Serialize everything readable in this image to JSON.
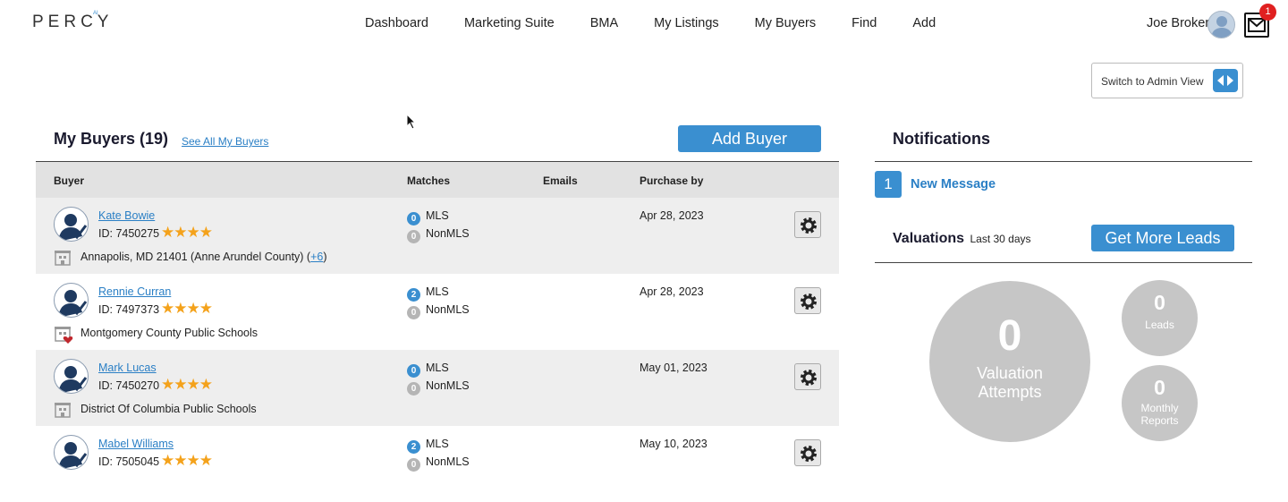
{
  "header": {
    "logo": "PERCY",
    "logo_sup": "AI",
    "nav": [
      "Dashboard",
      "Marketing Suite",
      "BMA",
      "My Listings",
      "My Buyers",
      "Find",
      "Add"
    ],
    "user_name": "Joe Broker",
    "mail_badge": "1"
  },
  "admin_toggle_label": "Switch to Admin View",
  "buyers": {
    "title": "My Buyers (19)",
    "see_all": "See All My Buyers",
    "add_button": "Add Buyer",
    "columns": {
      "buyer": "Buyer",
      "matches": "Matches",
      "emails": "Emails",
      "purchase_by": "Purchase by"
    },
    "rows": [
      {
        "name": "Kate Bowie",
        "id": "ID: 7450275",
        "stars": "★★★★",
        "location": "Annapolis, MD 21401 (Anne Arundel County) (",
        "location_more": "+6",
        "location_end": ")",
        "mls": "0",
        "nonmls": "0",
        "purchase_by": "Apr 28, 2023"
      },
      {
        "name": "Rennie Curran",
        "id": "ID: 7497373",
        "stars": "★★★★",
        "location": "Montgomery County Public Schools",
        "mls": "2",
        "nonmls": "0",
        "purchase_by": "Apr 28, 2023"
      },
      {
        "name": "Mark Lucas",
        "id": "ID: 7450270",
        "stars": "★★★★",
        "location": "District Of Columbia Public Schools",
        "mls": "0",
        "nonmls": "0",
        "purchase_by": "May 01, 2023"
      },
      {
        "name": "Mabel Williams",
        "id": "ID: 7505045",
        "stars": "★★★★",
        "location": "",
        "mls": "2",
        "nonmls": "0",
        "purchase_by": "May 10, 2023"
      }
    ],
    "mls_label": "MLS",
    "nonmls_label": "NonMLS"
  },
  "notifications": {
    "title": "Notifications",
    "count": "1",
    "message": "New Message"
  },
  "valuations": {
    "title": "Valuations",
    "subtitle": "Last 30 days",
    "button": "Get More Leads",
    "attempts_value": "0",
    "attempts_label_1": "Valuation",
    "attempts_label_2": "Attempts",
    "leads_value": "0",
    "leads_label": "Leads",
    "reports_value": "0",
    "reports_label_1": "Monthly",
    "reports_label_2": "Reports"
  }
}
